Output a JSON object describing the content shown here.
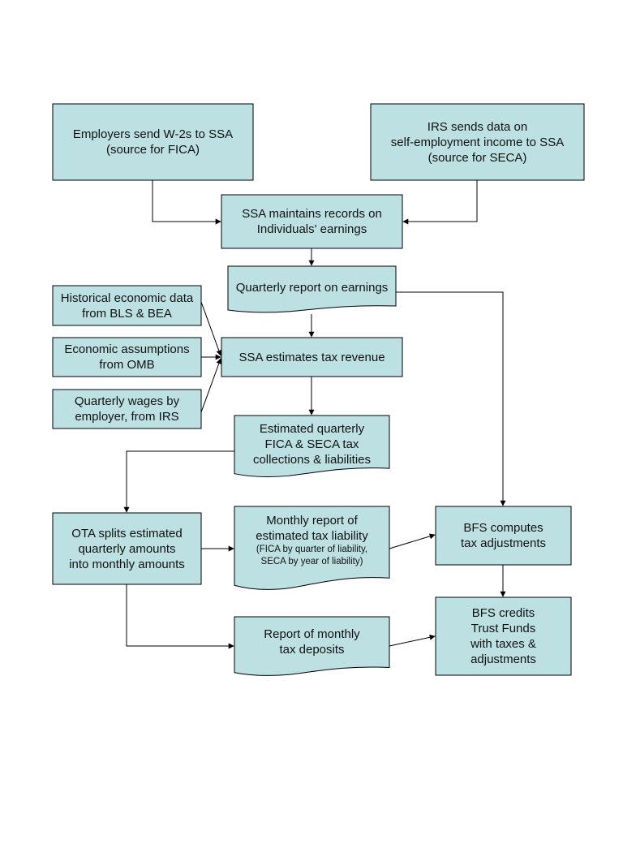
{
  "diagram": {
    "type": "flowchart",
    "colors": {
      "fill": "#bde0e3",
      "stroke": "#000000",
      "background": "#ffffff"
    },
    "nodes": {
      "employers": {
        "shape": "process",
        "lines": [
          "Employers send W-2s to SSA",
          "(source for FICA)"
        ]
      },
      "irs_self": {
        "shape": "process",
        "lines": [
          "IRS sends data on",
          "self-employment  income to SSA",
          "(source for SECA)"
        ]
      },
      "ssa_records": {
        "shape": "process",
        "lines": [
          "SSA maintains records on",
          "Individuals'  earnings"
        ]
      },
      "quarterly_report": {
        "shape": "document",
        "lines": [
          "Quarterly  report on earnings"
        ]
      },
      "historical": {
        "shape": "process",
        "lines": [
          "Historical economic data",
          "from BLS & BEA"
        ]
      },
      "assumptions": {
        "shape": "process",
        "lines": [
          "Economic assumptions",
          "from OMB"
        ]
      },
      "wages": {
        "shape": "process",
        "lines": [
          "Quarterly  wages by",
          "employer,  from IRS"
        ]
      },
      "ssa_estimates": {
        "shape": "process",
        "lines": [
          "SSA estimates tax  revenue"
        ]
      },
      "estimated_collections": {
        "shape": "document",
        "lines": [
          "Estimated quarterly",
          "FICA & SECA tax",
          "collections  & liabilities"
        ]
      },
      "ota_splits": {
        "shape": "process",
        "lines": [
          "OTA splits estimated",
          "quarterly  amounts",
          "into monthly  amounts"
        ]
      },
      "monthly_report": {
        "shape": "document",
        "lines": [
          "Monthly  report of",
          "estimated tax liability"
        ],
        "small_lines": [
          "(FICA by quarter of liability,",
          "SECA by year of liability)"
        ]
      },
      "bfs_computes": {
        "shape": "process",
        "lines": [
          "BFS computes",
          "tax  adjustments"
        ]
      },
      "monthly_deposits": {
        "shape": "document",
        "lines": [
          "Report of monthly",
          "tax deposits"
        ]
      },
      "bfs_credits": {
        "shape": "process",
        "lines": [
          "BFS credits",
          "Trust  Funds",
          "with taxes &",
          "adjustments"
        ]
      }
    },
    "edges": [
      {
        "from": "employers",
        "to": "ssa_records"
      },
      {
        "from": "irs_self",
        "to": "ssa_records"
      },
      {
        "from": "ssa_records",
        "to": "quarterly_report"
      },
      {
        "from": "quarterly_report",
        "to": "ssa_estimates"
      },
      {
        "from": "quarterly_report",
        "to": "bfs_computes"
      },
      {
        "from": "historical",
        "to": "ssa_estimates"
      },
      {
        "from": "assumptions",
        "to": "ssa_estimates"
      },
      {
        "from": "wages",
        "to": "ssa_estimates"
      },
      {
        "from": "ssa_estimates",
        "to": "estimated_collections"
      },
      {
        "from": "estimated_collections",
        "to": "ota_splits"
      },
      {
        "from": "ota_splits",
        "to": "monthly_report"
      },
      {
        "from": "ota_splits",
        "to": "monthly_deposits"
      },
      {
        "from": "monthly_report",
        "to": "bfs_computes"
      },
      {
        "from": "bfs_computes",
        "to": "bfs_credits"
      },
      {
        "from": "monthly_deposits",
        "to": "bfs_credits"
      }
    ]
  }
}
